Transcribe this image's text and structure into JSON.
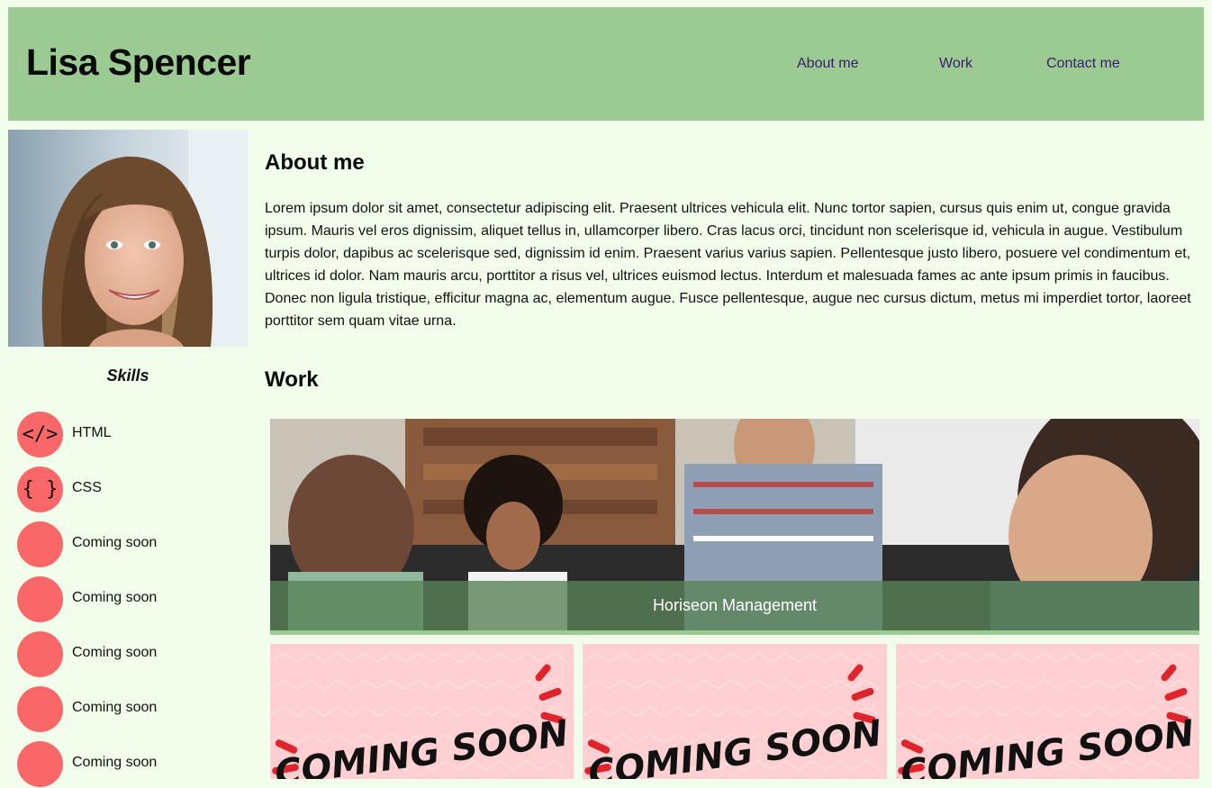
{
  "header": {
    "title": "Lisa Spencer",
    "nav": [
      "About me",
      "Work",
      "Contact me"
    ]
  },
  "sidebar": {
    "skills_title": "Skills",
    "skills": [
      {
        "label": "HTML",
        "icon": "code-icon",
        "glyph": "</>"
      },
      {
        "label": "CSS",
        "icon": "braces-icon",
        "glyph": "{ }"
      },
      {
        "label": "Coming soon",
        "icon": "blank-circle-icon",
        "glyph": ""
      },
      {
        "label": "Coming soon",
        "icon": "blank-circle-icon",
        "glyph": ""
      },
      {
        "label": "Coming soon",
        "icon": "blank-circle-icon",
        "glyph": ""
      },
      {
        "label": "Coming soon",
        "icon": "blank-circle-icon",
        "glyph": ""
      },
      {
        "label": "Coming soon",
        "icon": "blank-circle-icon",
        "glyph": ""
      }
    ]
  },
  "about": {
    "heading": "About me",
    "text": "Lorem ipsum dolor sit amet, consectetur adipiscing elit. Praesent ultrices vehicula elit. Nunc tortor sapien, cursus quis enim ut, congue gravida ipsum. Mauris vel eros dignissim, aliquet tellus in, ullamcorper libero. Cras lacus orci, tincidunt non scelerisque id, vehicula in augue. Vestibulum turpis dolor, dapibus ac scelerisque sed, dignissim id enim. Praesent varius varius sapien. Pellentesque justo libero, posuere vel condimentum et, ultrices id dolor. Nam mauris arcu, porttitor a risus vel, ultrices euismod lectus. Interdum et malesuada fames ac ante ipsum primis in faucibus. Donec non ligula tristique, efficitur magna ac, elementum augue. Fusce pellentesque, augue nec cursus dictum, metus mi imperdiet tortor, laoreet porttitor sem quam vitae urna."
  },
  "work": {
    "heading": "Work",
    "featured_caption": "Horiseon Management",
    "tiles": [
      "COMING SOON",
      "COMING SOON",
      "COMING SOON"
    ]
  },
  "colors": {
    "header_bg": "#9bcb93",
    "page_bg": "#f1feeb",
    "nav_link": "#3c1a6e",
    "skill_circle": "#fa6769",
    "tile_bg": "#ffcfd2"
  }
}
